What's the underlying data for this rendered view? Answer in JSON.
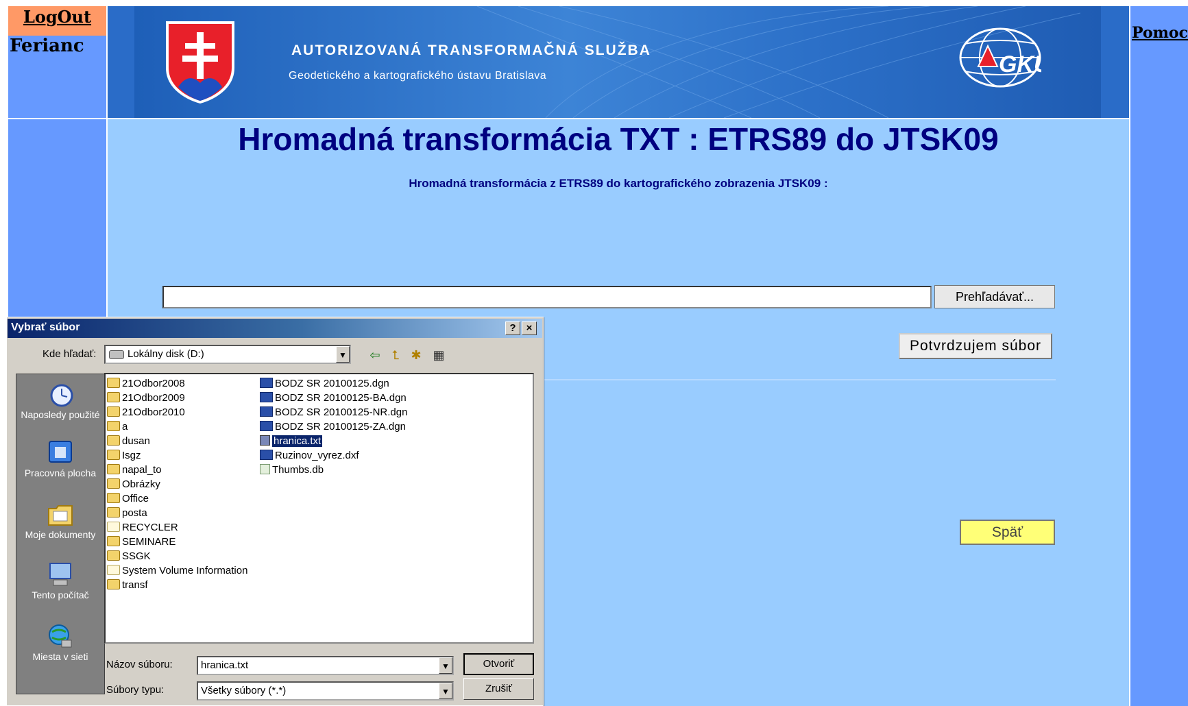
{
  "sidebar": {
    "logout": "LogOut",
    "username": "Ferianc"
  },
  "banner": {
    "title": "AUTORIZOVANÁ TRANSFORMAČNÁ SLUŽBA",
    "subtitle": "Geodetického a kartografického ústavu Bratislava",
    "logo_text": "GKÚ"
  },
  "help_link": "Pomoc",
  "main": {
    "title": "Hromadná transformácia TXT : ETRS89 do JTSK09",
    "subtitle": "Hromadná transformácia z ETRS89 do kartografického zobrazenia  JTSK09 :",
    "browse_label": "Prehľadávať...",
    "file_input_value": "",
    "confirm_label": "Potvrdzujem súbor",
    "back_label": "Späť"
  },
  "dialog": {
    "title": "Vybrať súbor",
    "help_btn": "?",
    "close_btn": "×",
    "look_in_label": "Kde hľadať:",
    "look_in_value": "Lokálny disk (D:)",
    "places": [
      {
        "label": "Naposledy použité",
        "icon": "recent-icon"
      },
      {
        "label": "Pracovná plocha",
        "icon": "desktop-icon"
      },
      {
        "label": "Moje dokumenty",
        "icon": "my-documents-icon"
      },
      {
        "label": "Tento počítač",
        "icon": "my-computer-icon"
      },
      {
        "label": "Miesta v sieti",
        "icon": "network-icon"
      }
    ],
    "folders": [
      "21Odbor2008",
      "21Odbor2009",
      "21Odbor2010",
      "a",
      "dusan",
      "Isgz",
      "napal_to",
      "Obrázky",
      "Office",
      "posta",
      "RECYCLER",
      "SEMINARE",
      "SSGK",
      "System Volume Information",
      "transf"
    ],
    "files": [
      "BODZ SR 20100125.dgn",
      "BODZ SR 20100125-BA.dgn",
      "BODZ SR 20100125-NR.dgn",
      "BODZ SR 20100125-ZA.dgn",
      "hranica.txt",
      "Ruzinov_vyrez.dxf",
      "Thumbs.db"
    ],
    "selected_file": "hranica.txt",
    "file_name_label": "Názov súboru:",
    "file_name_value": "hranica.txt",
    "file_type_label": "Súbory typu:",
    "file_type_value": "Všetky súbory (*.*)",
    "open_label": "Otvoriť",
    "cancel_label": "Zrušiť"
  }
}
